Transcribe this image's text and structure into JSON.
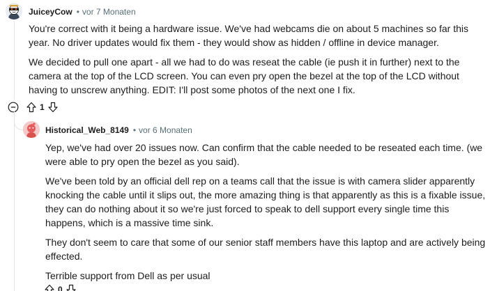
{
  "comment": {
    "author": "JuiceyCow",
    "separator": "•",
    "time": "vor 7 Monaten",
    "paragraphs": [
      "You're correct with it being a hardware issue. We've had webcams die on about 5 machines so far this year. No driver updates would fix them - they would show as hidden / offline in device manager.",
      "We decided to pull one apart - all we had to do was reseat the cable (ie push it in further) next to the camera at the top of the LCD screen. You can even pry open the bezel at the top of the LCD without having to unscrew anything. EDIT: I'll post some photos of the next one I fix."
    ],
    "score": "1"
  },
  "reply": {
    "author": "Historical_Web_8149",
    "separator": "•",
    "time": "vor 6 Monaten",
    "paragraphs": [
      "Yep, we've had over 20 issues now. Can confirm that the cable needed to be reseated each time. (we were able to pry open the bezel as you said).",
      "We've been told by an official dell rep on a teams call that the issue is with camera slider apparently knocking the cable until it slips out, the more amazing thing is that apparently as this is a fixable issue, they can do nothing about it so we're just forced to speak to dell support every single time this happens, which is a massive time sink.",
      "They don't seem to care that some of our senior staff members have this laptop and are actively being effected.",
      "Terrible support from Dell as per usual"
    ],
    "score": "0"
  },
  "icons": {
    "collapse": "collapse-minus-icon",
    "upvote": "upvote-arrow-icon",
    "downvote": "downvote-arrow-icon"
  },
  "colors": {
    "meta": "#576f76",
    "text": "#1c1c1c",
    "thread_line": "#e0e4e6"
  }
}
